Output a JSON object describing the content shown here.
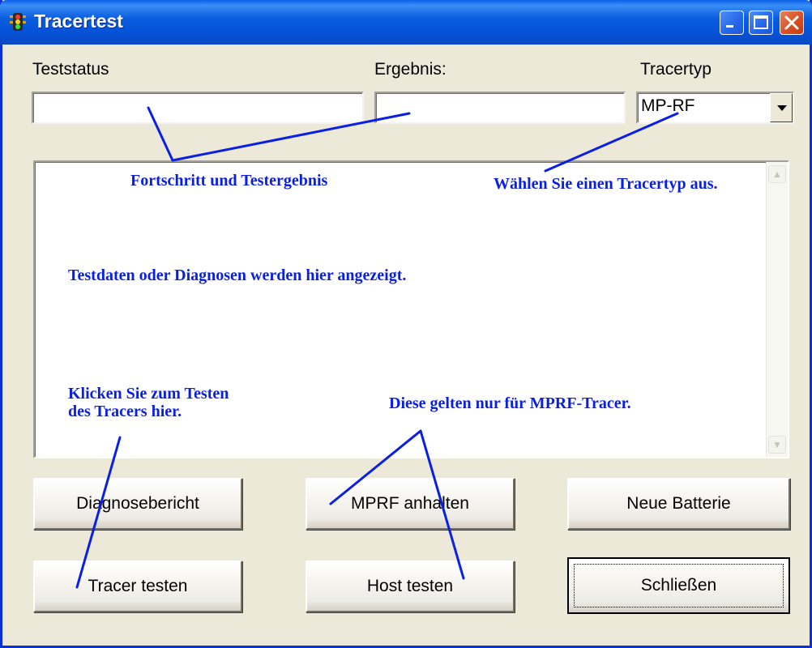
{
  "window": {
    "title": "Tracertest",
    "icon": "traffic-light-icon",
    "controls": [
      "minimize-icon",
      "maximize-icon",
      "close-icon"
    ]
  },
  "labels": {
    "teststatus": "Teststatus",
    "ergebnis": "Ergebnis:",
    "tracertyp": "Tracertyp"
  },
  "fields": {
    "teststatus_value": "",
    "ergebnis_value": "",
    "tracertyp_selected": "MP-RF"
  },
  "buttons": {
    "diagnosebericht": "Diagnosebericht",
    "mprf_anhalten": "MPRF anhalten",
    "neue_batterie": "Neue Batterie",
    "tracer_testen": "Tracer testen",
    "host_testen": "Host testen",
    "schliessen": "Schließen"
  },
  "annotations": {
    "fortschritt": "Fortschritt und Testergebnis",
    "waehlen": "Wählen Sie einen Tracertyp aus.",
    "testdaten": "Testdaten oder Diagnosen werden hier angezeigt.",
    "klicken_line1": "Klicken Sie zum Testen",
    "klicken_line2": "des Tracers hier.",
    "mprf_only": "Diese gelten nur für MPRF-Tracer."
  },
  "colors": {
    "annotation": "#0a1fe6",
    "titlebar": "#0553d8",
    "dialog_bg": "#ece9d8"
  }
}
